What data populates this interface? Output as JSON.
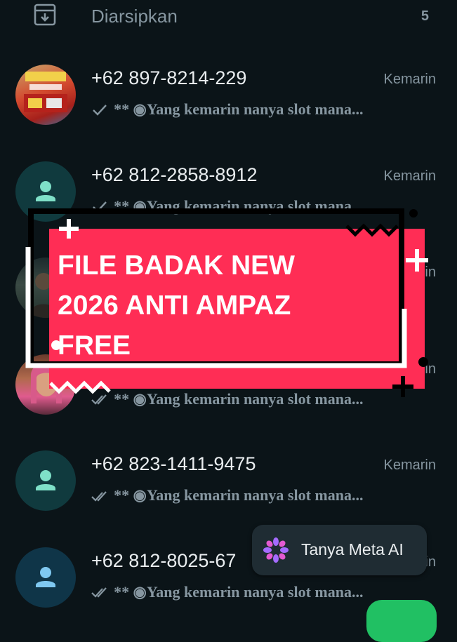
{
  "archive": {
    "label": "Diarsipkan",
    "count": "5",
    "icon": "archive-icon"
  },
  "chats": [
    {
      "name": "+62 897-8214-229",
      "time": "Kemarin",
      "preview": "**  ◉Yang kemarin nanya slot mana...",
      "tick": "single",
      "avatar": "photo-promo"
    },
    {
      "name": "+62 812-2858-8912",
      "time": "Kemarin",
      "preview": "**  ◉Yang kemarin nanya slot mana...",
      "tick": "single",
      "avatar": "default"
    },
    {
      "name": "",
      "time": "Kemarin",
      "preview": "",
      "tick": "none",
      "avatar": "photo-night"
    },
    {
      "name": "",
      "time": "Kemarin",
      "preview": "**  ◉Yang kemarin nanya slot mana...",
      "tick": "double",
      "avatar": "photo-woman"
    },
    {
      "name": "+62 823-1411-9475",
      "time": "Kemarin",
      "preview": "**  ◉Yang kemarin nanya slot mana...",
      "tick": "double",
      "avatar": "default"
    },
    {
      "name": "+62 812-8025-67",
      "time": "Kemarin",
      "preview": "**  ◉Yang kemarin nanya slot mana...",
      "tick": "double",
      "avatar": "default"
    }
  ],
  "banner": {
    "line1": "FILE BADAK NEW",
    "line2": "2026 ANTI AMPAZ",
    "line3": "FREE",
    "color": "#ff2d55"
  },
  "meta_ai": {
    "label": "Tanya Meta AI"
  },
  "colors": {
    "background": "#0b1418",
    "primary_text": "#e9edef",
    "secondary_text": "#8696a0",
    "avatar_bg": "#103a3e",
    "avatar_icon": "#7fe0c8",
    "fab": "#21c063"
  }
}
